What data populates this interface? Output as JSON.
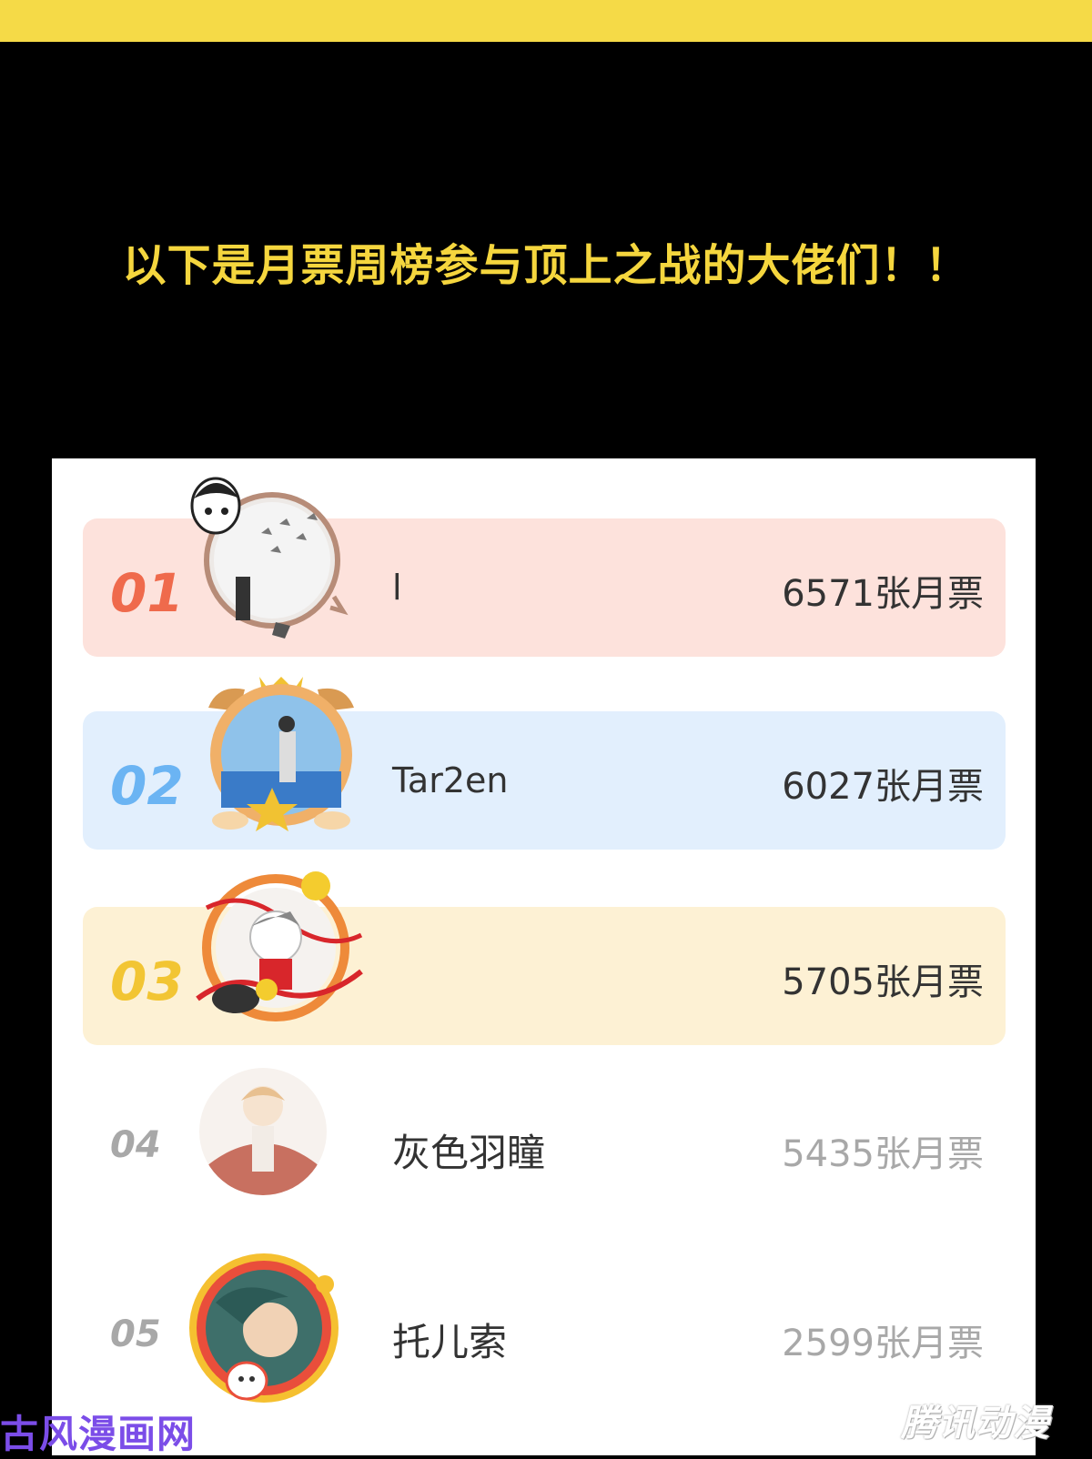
{
  "headline": "以下是月票周榜参与顶上之战的大佬们！！",
  "ranking": [
    {
      "rank": "01",
      "name": "l",
      "votes": "6571张月票",
      "accent": "#ef6a4c",
      "bg": "#fde2dc"
    },
    {
      "rank": "02",
      "name": "Tar2en",
      "votes": "6027张月票",
      "accent": "#6bb4f3",
      "bg": "#e2effd"
    },
    {
      "rank": "03",
      "name": "",
      "votes": "5705张月票",
      "accent": "#f2c533",
      "bg": "#fdf1d4"
    },
    {
      "rank": "04",
      "name": "灰色羽瞳",
      "votes": "5435张月票"
    },
    {
      "rank": "05",
      "name": "托儿索",
      "votes": "2599张月票"
    }
  ],
  "watermarks": {
    "left": "古风漫画网",
    "right": "腾讯动漫"
  },
  "colors": {
    "top_bar": "#f5da47",
    "headline": "#f5d63e",
    "background": "#000000"
  }
}
